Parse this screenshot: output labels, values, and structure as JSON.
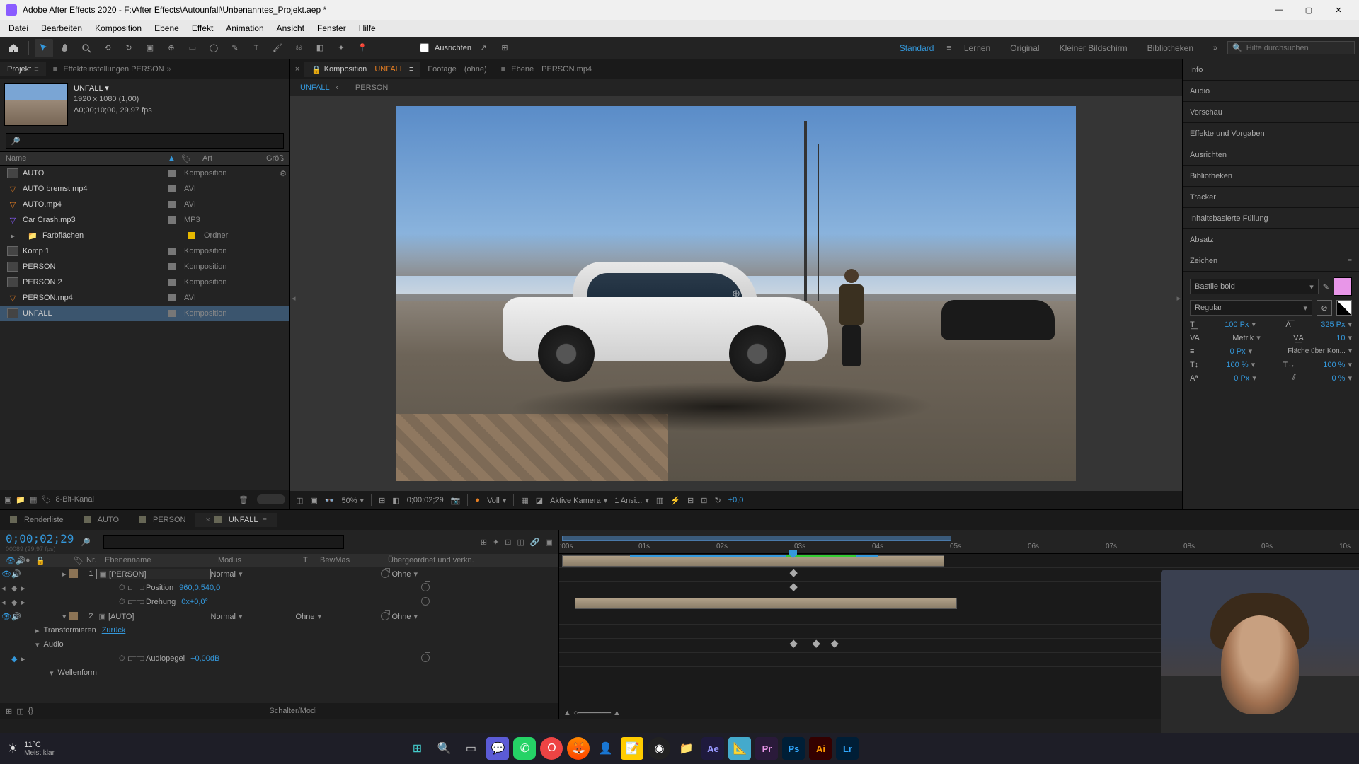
{
  "titlebar": {
    "text": "Adobe After Effects 2020 - F:\\After Effects\\Autounfall\\Unbenanntes_Projekt.aep *"
  },
  "menubar": [
    "Datei",
    "Bearbeiten",
    "Komposition",
    "Ebene",
    "Effekt",
    "Animation",
    "Ansicht",
    "Fenster",
    "Hilfe"
  ],
  "toolbar": {
    "snap_label": "Ausrichten",
    "workspaces": [
      "Standard",
      "Lernen",
      "Original",
      "Kleiner Bildschirm",
      "Bibliotheken"
    ],
    "active_workspace": 0,
    "search_placeholder": "Hilfe durchsuchen"
  },
  "project_panel": {
    "tabs": [
      {
        "label": "Projekt",
        "active": true
      },
      {
        "label": "Effekteinstellungen  PERSON",
        "active": false
      }
    ],
    "comp_name": "UNFALL ▾",
    "comp_res": "1920 x 1080 (1,00)",
    "comp_dur": "Δ0;00;10;00, 29,97 fps",
    "cols": {
      "name": "Name",
      "art": "Art",
      "size": "Größ"
    },
    "items": [
      {
        "name": "AUTO",
        "type": "Komposition",
        "icon": "comp",
        "gear": true
      },
      {
        "name": "AUTO bremst.mp4",
        "type": "AVI",
        "icon": "vid"
      },
      {
        "name": "AUTO.mp4",
        "type": "AVI",
        "icon": "vid"
      },
      {
        "name": "Car Crash.mp3",
        "type": "MP3",
        "icon": "aud"
      },
      {
        "name": "Farbflächen",
        "type": "Ordner",
        "icon": "fold",
        "swatch": "#e6b800"
      },
      {
        "name": "Komp 1",
        "type": "Komposition",
        "icon": "comp"
      },
      {
        "name": "PERSON",
        "type": "Komposition",
        "icon": "comp"
      },
      {
        "name": "PERSON 2",
        "type": "Komposition",
        "icon": "comp"
      },
      {
        "name": "PERSON.mp4",
        "type": "AVI",
        "icon": "vid"
      },
      {
        "name": "UNFALL",
        "type": "Komposition",
        "icon": "comp",
        "selected": true
      }
    ],
    "footer_bpc": "8-Bit-Kanal"
  },
  "composition": {
    "tabs": [
      {
        "prefix": "Komposition",
        "name": "UNFALL",
        "active": true,
        "locked": true
      },
      {
        "prefix": "Footage",
        "name": "(ohne)",
        "active": false
      },
      {
        "prefix": "Ebene",
        "name": "PERSON.mp4",
        "active": false
      }
    ],
    "subtabs": [
      {
        "name": "UNFALL",
        "active": true,
        "caret": "‹"
      },
      {
        "name": "PERSON",
        "active": false
      }
    ]
  },
  "viewer_bar": {
    "zoom": "50%",
    "timecode": "0;00;02;29",
    "res": "Voll",
    "camera": "Aktive Kamera",
    "views": "1 Ansi...",
    "exposure": "+0,0"
  },
  "right_panels": [
    "Info",
    "Audio",
    "Vorschau",
    "Effekte und Vorgaben",
    "Ausrichten",
    "Bibliotheken",
    "Tracker",
    "Inhaltsbasierte Füllung",
    "Absatz",
    "Zeichen"
  ],
  "character": {
    "font": "Bastile bold",
    "style": "Regular",
    "size": "100 Px",
    "leading": "325 Px",
    "kerning": "Metrik",
    "tracking": "10",
    "stroke": "0 Px",
    "stroke_mode": "Fläche über Kon...",
    "hscale": "100 %",
    "vscale": "100 %",
    "baseline": "0 Px",
    "tsume": "0 %",
    "swatch": "#e896e8"
  },
  "timeline": {
    "tabs": [
      {
        "name": "Renderliste",
        "active": false
      },
      {
        "name": "AUTO",
        "active": false
      },
      {
        "name": "PERSON",
        "active": false
      },
      {
        "name": "UNFALL",
        "active": true
      }
    ],
    "timecode": "0;00;02;29",
    "timecode_sub": "00089 (29,97 fps)",
    "cols": {
      "nr": "Nr.",
      "name": "Ebenenname",
      "mode": "Modus",
      "trk": "T",
      "bewmas": "BewMas",
      "parent": "Übergeordnet und verkn."
    },
    "layers": [
      {
        "num": "1",
        "name": "[PERSON]",
        "boxed": true,
        "mode": "Normal",
        "parent": "Ohne",
        "props": [
          {
            "label": "Position",
            "value": "960,0,540,0",
            "animated": true
          },
          {
            "label": "Drehung",
            "value": "0x+0,0°",
            "animated": true
          }
        ]
      },
      {
        "num": "2",
        "name": "[AUTO]",
        "mode": "Normal",
        "trkmat": "Ohne",
        "parent": "Ohne",
        "group": "Transformieren",
        "group_val": "Zurück",
        "audio_group": "Audio",
        "audio_prop": {
          "label": "Audiopegel",
          "value": "+0,00dB",
          "animated": true
        },
        "wave": "Wellenform"
      }
    ],
    "ruler_ticks": [
      ":00s",
      "01s",
      "02s",
      "03s",
      "04s",
      "05s",
      "06s",
      "07s",
      "08s",
      "09s",
      "10s"
    ],
    "footer": "Schalter/Modi"
  },
  "taskbar": {
    "temp": "11°C",
    "cond": "Meist klar"
  }
}
